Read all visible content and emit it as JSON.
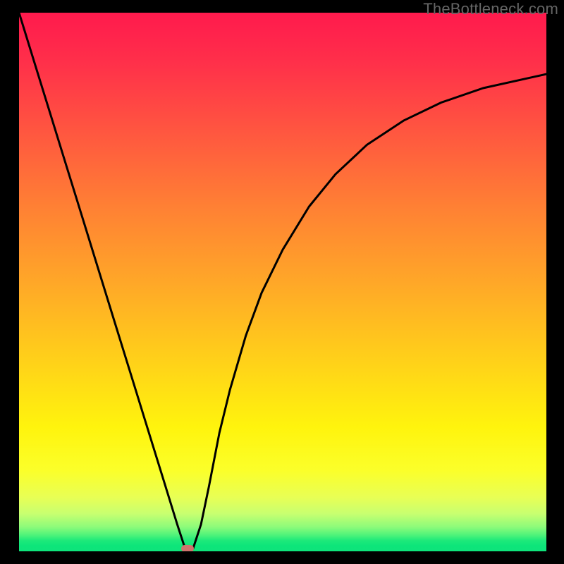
{
  "watermark": "TheBottleneck.com",
  "colors": {
    "frame": "#000000",
    "curve": "#000000",
    "marker": "#d0736d"
  },
  "chart_data": {
    "type": "line",
    "title": "",
    "xlabel": "",
    "ylabel": "",
    "xlim": [
      0,
      100
    ],
    "ylim": [
      0,
      100
    ],
    "grid": false,
    "legend": false,
    "annotations": [
      "TheBottleneck.com"
    ],
    "series": [
      {
        "name": "bottleneck-curve",
        "x": [
          0,
          3,
          6,
          9,
          12,
          15,
          18,
          21,
          24,
          27,
          30,
          31.5,
          33,
          34.5,
          36,
          38,
          40,
          43,
          46,
          50,
          55,
          60,
          66,
          73,
          80,
          88,
          100
        ],
        "y": [
          100,
          90.5,
          81,
          71.5,
          62,
          52.5,
          43,
          33.5,
          24,
          14.5,
          5,
          0.5,
          0.5,
          5,
          12,
          22,
          30,
          40,
          48,
          56,
          64,
          70,
          75.5,
          80,
          83.3,
          86,
          88.6
        ]
      }
    ],
    "marker": {
      "x": 32,
      "y": 0
    }
  }
}
